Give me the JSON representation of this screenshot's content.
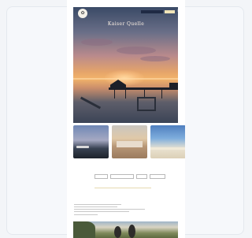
{
  "header": {
    "logo_text": "✿",
    "book_label": "",
    "gift_label": "",
    "menu_glyph": "≡"
  },
  "hero": {
    "title": "Kaiser Quelle",
    "subtitle": ""
  },
  "tiles": [
    {
      "label": ""
    },
    {
      "label": ""
    },
    {
      "label": ""
    }
  ],
  "section": {
    "label": "",
    "filters": [
      "",
      "",
      "",
      ""
    ]
  },
  "article": {
    "heading": "",
    "body": ""
  },
  "colors": {
    "navy": "#1f2a44",
    "gold": "#f0e4b8",
    "sunset": "#f2b36a"
  }
}
